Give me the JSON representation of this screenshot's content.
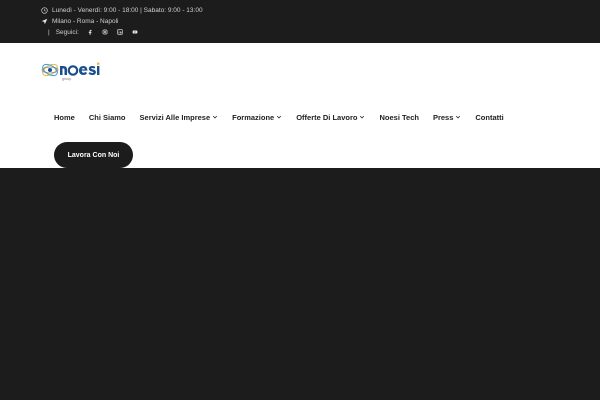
{
  "topbar": {
    "hours": "Lunedì - Venerdì: 9:00 - 18:00 | Sabato: 9:00 - 13:00",
    "locations": "Milano - Roma - Napoli",
    "separator": "|",
    "follow_label": "Seguici:",
    "social": [
      "facebook-icon",
      "instagram-icon",
      "linkedin-icon",
      "youtube-icon"
    ],
    "hours_icon": "clock-icon",
    "location_icon": "location-arrow-icon"
  },
  "logo": {
    "text": "noesi",
    "tagline": "group"
  },
  "nav": {
    "items": [
      {
        "label": "Home",
        "dropdown": false
      },
      {
        "label": "Chi Siamo",
        "dropdown": false
      },
      {
        "label": "Servizi Alle Imprese",
        "dropdown": true
      },
      {
        "label": "Formazione",
        "dropdown": true
      },
      {
        "label": "Offerte Di Lavoro",
        "dropdown": true
      },
      {
        "label": "Noesi Tech",
        "dropdown": false
      },
      {
        "label": "Press",
        "dropdown": true
      },
      {
        "label": "Contatti",
        "dropdown": false
      }
    ],
    "cta": "Lavora Con Noi"
  },
  "colors": {
    "dark": "#1c1c1c",
    "header_bg": "#ffffff",
    "logo_blue": "#1a4e8c",
    "logo_accent": "#e8b93a"
  }
}
